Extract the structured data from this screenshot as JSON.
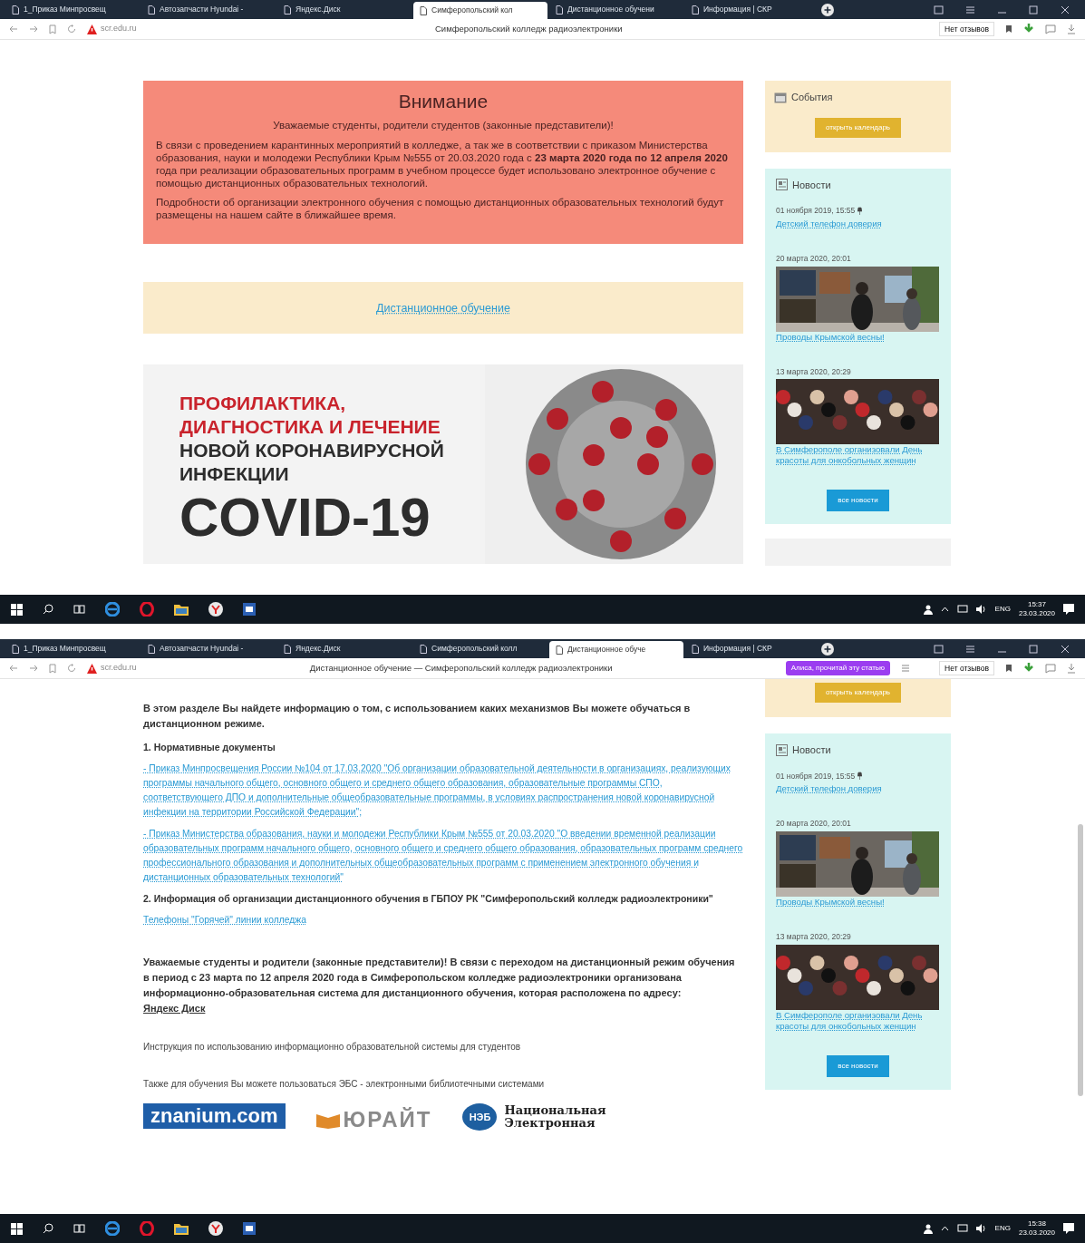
{
  "screens": [
    {
      "browser": {
        "tabs": [
          {
            "label": "1_Приказ Минпросвещ",
            "selected": false
          },
          {
            "label": "Автозапчасти Hyundai -",
            "selected": false
          },
          {
            "label": "Яндекс.Диск",
            "selected": false
          },
          {
            "label": "Симферопольский кол",
            "selected": true
          },
          {
            "label": "Дистанционное обучени",
            "selected": false
          },
          {
            "label": "Информация | СКР",
            "selected": false
          }
        ],
        "address": "scr.edu.ru",
        "page_title": "Симферопольский колледж радиоэлектроники",
        "reviews": "Нет отзывов"
      },
      "main": [
        {
          "kind": "alert",
          "title": "Внимание",
          "subtitle": "Уважаемые студенты, родители студентов (законные представители)!",
          "paragraphs": [
            "В связи с проведением карантинных мероприятий в колледже, а так же в соответствии с приказом Министерства образования, науки и молодежи Республики Крым №555 от 20.03.2020 года с **23 марта 2020 года по 12 апреля 2020** года при реализации образовательных программ в учебном процессе будет использовано электронное обучение с помощью дистанционных образовательных технологий.",
            "Подробности об организации электронного обучения с помощью дистанционных образовательных технологий будут размещены на нашем сайте в ближайшее время."
          ]
        },
        {
          "kind": "link_card",
          "link": "Дистанционное обучение"
        },
        {
          "kind": "banner",
          "red_lines": [
            "ПРОФИЛАКТИКА,",
            "ДИАГНОСТИКА И ЛЕЧЕНИЕ"
          ],
          "dark_lines": [
            "НОВОЙ КОРОНАВИРУСНОЙ",
            "ИНФЕКЦИИ"
          ],
          "headline": "COVID-19"
        }
      ],
      "sidebar": [
        {
          "kind": "events",
          "title": "События",
          "button": "открыть календарь"
        },
        {
          "kind": "news",
          "title": "Новости",
          "items": [
            {
              "date": "01 ноября 2019, 15:55",
              "pinned": true,
              "kind": "text",
              "link": "Детский телефон доверия"
            },
            {
              "date": "20 марта 2020, 20:01",
              "pinned": false,
              "kind": "picture",
              "link": "Проводы Крымской весны!"
            },
            {
              "date": "13 марта 2020, 20:29",
              "pinned": false,
              "kind": "picture",
              "link": "В Симферополе организовали День красоты для онкобольных женщин"
            }
          ],
          "button": "все новости"
        },
        {
          "kind": "stub"
        }
      ],
      "taskbar": {
        "lang": "ENG",
        "time": "15:37",
        "date": "23.03.2020"
      }
    },
    {
      "browser": {
        "tabs": [
          {
            "label": "1_Приказ Минпросвещ",
            "selected": false
          },
          {
            "label": "Автозапчасти Hyundai -",
            "selected": false
          },
          {
            "label": "Яндекс.Диск",
            "selected": false
          },
          {
            "label": "Симферопольский колл",
            "selected": false
          },
          {
            "label": "Дистанционное обуче",
            "selected": true
          },
          {
            "label": "Информация | СКР",
            "selected": false
          }
        ],
        "address": "scr.edu.ru",
        "page_title": "Дистанционное обучение — Симферопольский колледж радиоэлектроники",
        "read_aloud": "Алиса, прочитай эту статью",
        "reviews": "Нет отзывов"
      },
      "main": [
        {
          "kind": "bold_text",
          "text": "В этом разделе Вы найдете информацию о том, с использованием каких механизмов Вы можете обучаться в дистанционном режиме."
        },
        {
          "kind": "heading",
          "text": "1. Нормативные документы"
        },
        {
          "kind": "link",
          "text": "- Приказ Минпросвещения России №104 от 17.03.2020 \"Об организации образовательной деятельности в организациях, реализующих программы начального общего, основного общего и среднего общего образования, образовательные программы СПО, соответствующего ДПО и дополнительные общеобразовательные программы, в условиях распространения новой коронавирусной инфекции на территории Российской Федерации\";"
        },
        {
          "kind": "link",
          "text": "- Приказ Министерства образования, науки и молодежи Республики Крым №555 от 20.03.2020 \"О введении временной реализации образовательных программ начального общего, основного общего и среднего общего образования, образовательных программ среднего профессионального образования и дополнительных общеобразовательных программ с применением электронного обучения и дистанционных образовательных технологий\""
        },
        {
          "kind": "heading",
          "text": "2. Информация об организации дистанционного обучения в ГБПОУ РК \"Симферопольский колледж радиоэлектроники\""
        },
        {
          "kind": "link",
          "text": "Телефоны \"Горячей\" линии колледжа"
        },
        {
          "kind": "bold_text",
          "text": "Уважаемые студенты и родители (законные представители)! В связи с переходом на дистанционный режим обучения в период с 23 марта по 12 апреля 2020 года в Симферопольском колледже радиоэлектроники организована информационно-образовательная система для дистанционного обучения, которая расположена по адресу:",
          "link": "Яндекс Диск"
        },
        {
          "kind": "plain_text",
          "text": "Инструкция по использованию информационно образовательной системы для студентов"
        },
        {
          "kind": "plain_text",
          "text": "Также для обучения Вы можете пользоваться ЭБС - электронными библиотечными системами"
        },
        {
          "kind": "logos",
          "znanium": "znanium.com",
          "urait": "ЮРАЙТ",
          "neb_badge": "НЭБ",
          "neb_lines": [
            "Национальная",
            "Электронная"
          ]
        }
      ],
      "sidebar": [
        {
          "kind": "events",
          "button": "открыть календарь"
        },
        {
          "kind": "news",
          "title": "Новости",
          "items": [
            {
              "date": "01 ноября 2019, 15:55",
              "pinned": true,
              "kind": "text",
              "link": "Детский телефон доверия"
            },
            {
              "date": "20 марта 2020, 20:01",
              "pinned": false,
              "kind": "picture",
              "link": "Проводы Крымской весны!"
            },
            {
              "date": "13 марта 2020, 20:29",
              "pinned": false,
              "kind": "picture",
              "link": "В Симферополе организовали День красоты для онкобольных женщин"
            }
          ],
          "button": "все новости"
        }
      ],
      "taskbar": {
        "lang": "ENG",
        "time": "15:38",
        "date": "23.03.2020"
      }
    }
  ]
}
